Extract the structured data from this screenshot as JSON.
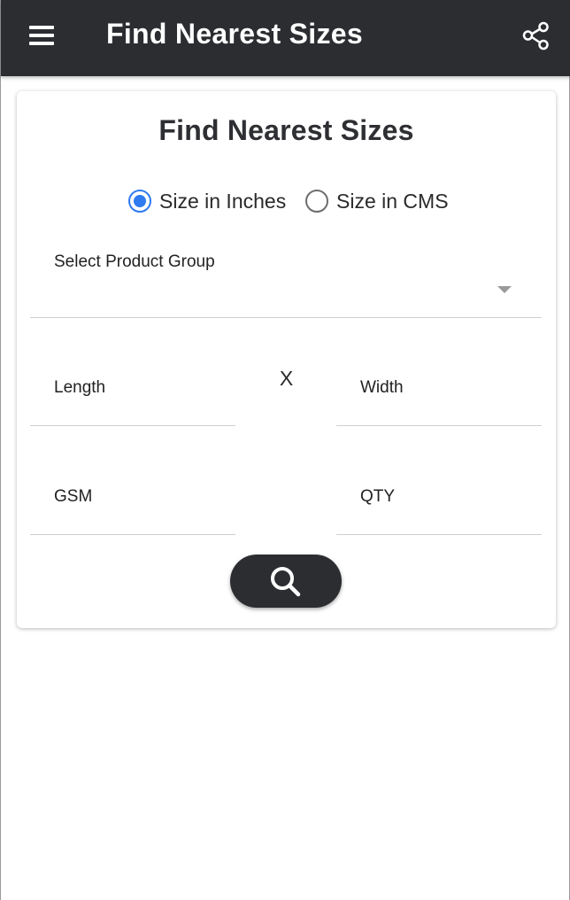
{
  "appbar": {
    "title": "Find Nearest Sizes",
    "menu_icon": "hamburger-menu-icon",
    "share_icon": "share-icon",
    "background": "#2b2d31"
  },
  "card": {
    "title": "Find Nearest Sizes",
    "unit_options": [
      {
        "label": "Size in Inches",
        "checked": true
      },
      {
        "label": "Size in CMS",
        "checked": false
      }
    ],
    "product_group": {
      "label": "Select Product Group",
      "value": ""
    },
    "length": {
      "label": "Length",
      "value": ""
    },
    "times_symbol": "X",
    "width": {
      "label": "Width",
      "value": ""
    },
    "gsm": {
      "label": "GSM",
      "value": ""
    },
    "qty": {
      "label": "QTY",
      "value": ""
    },
    "search_button": {
      "icon": "search-icon"
    }
  },
  "colors": {
    "accent": "#2f7bf0",
    "dark": "#2b2d31"
  }
}
